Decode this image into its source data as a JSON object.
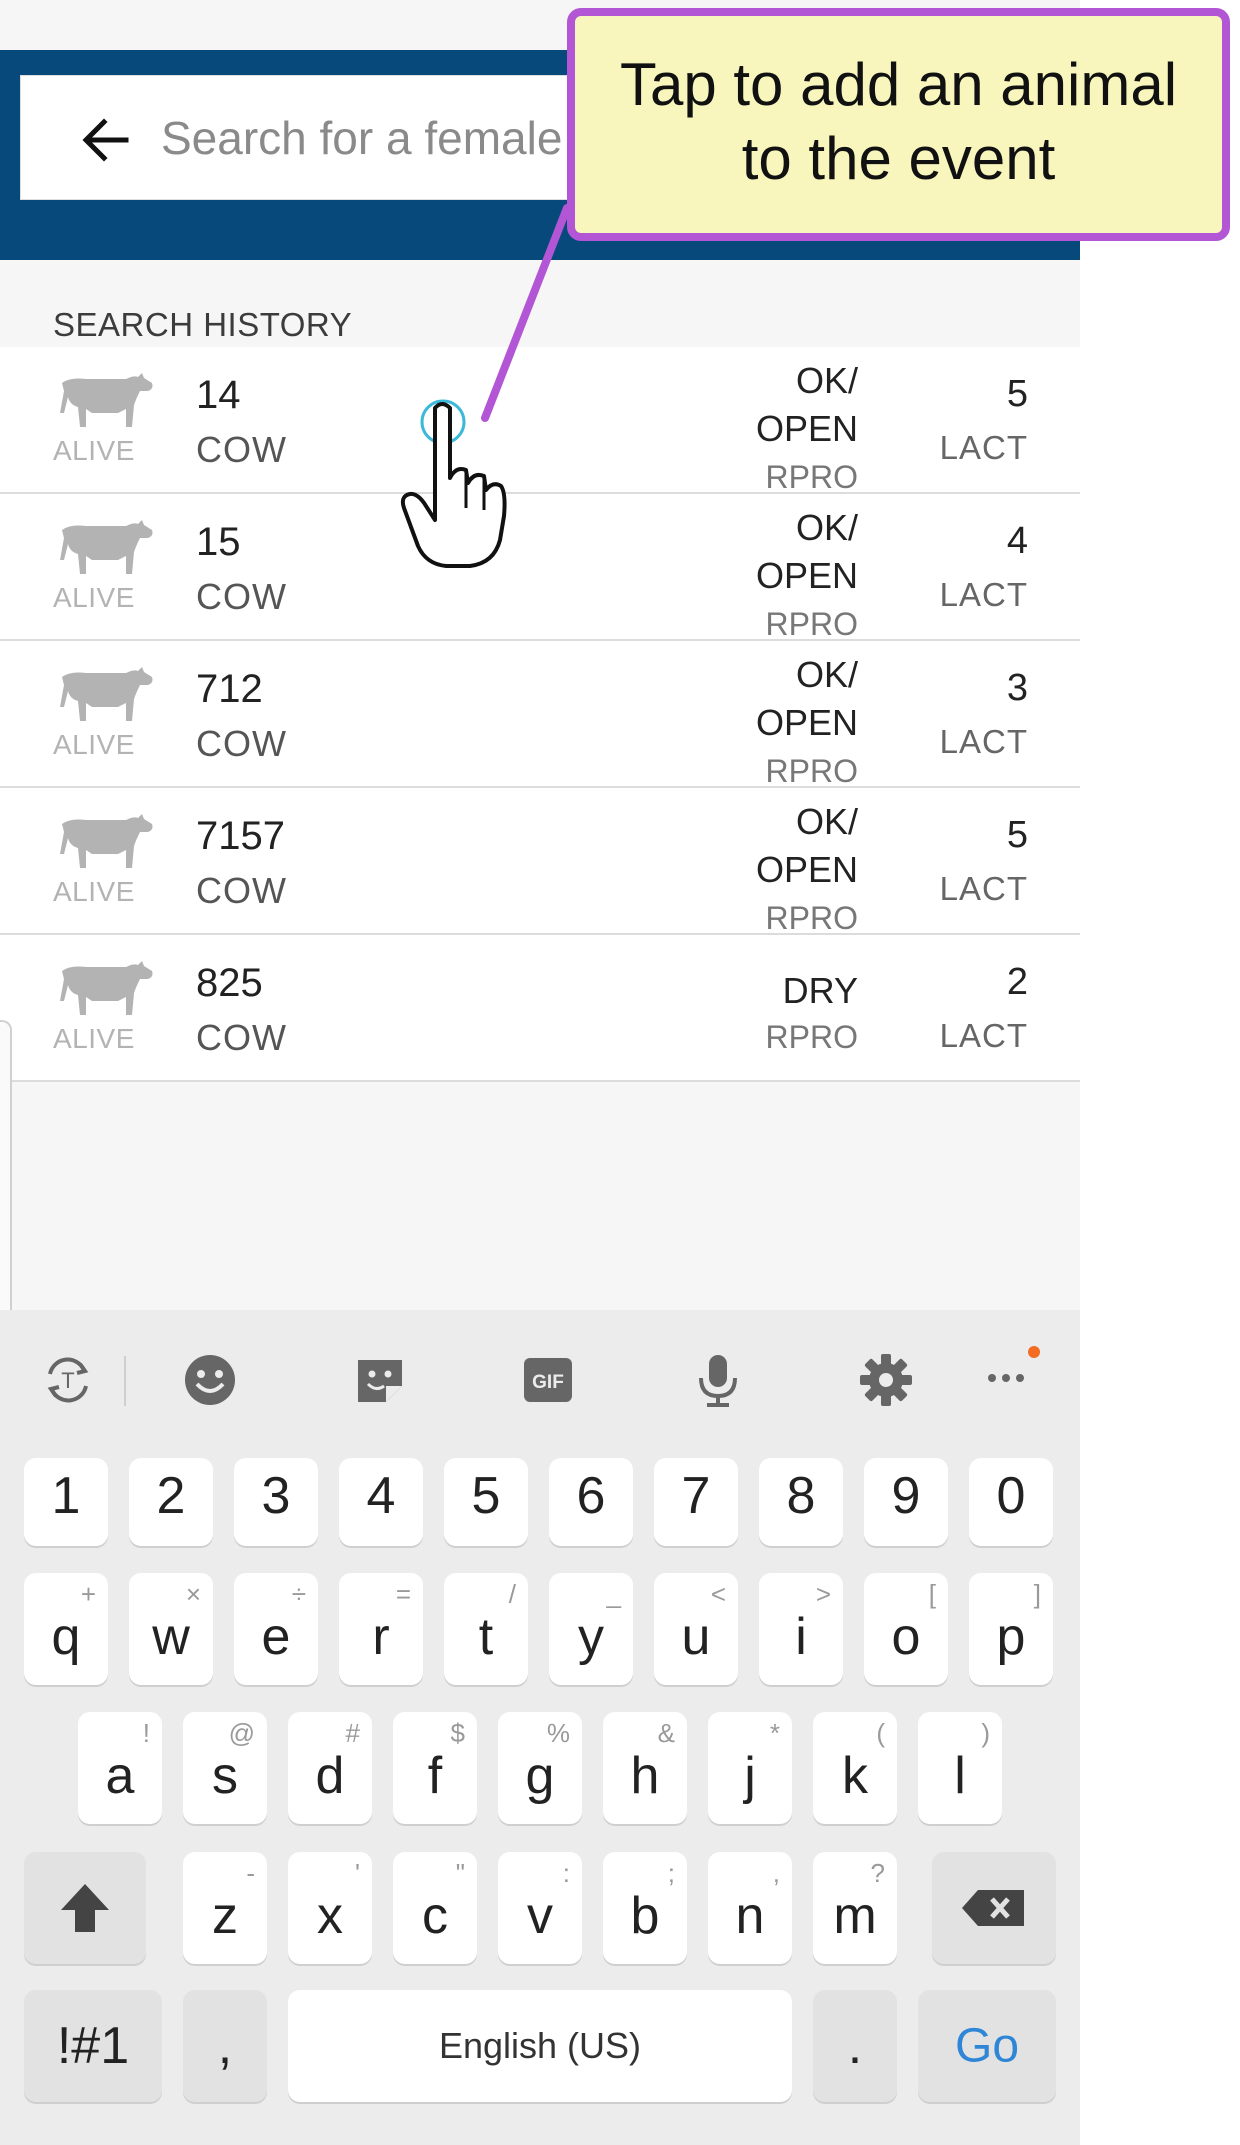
{
  "search": {
    "placeholder": "Search for a female"
  },
  "history": {
    "header": "SEARCH HISTORY",
    "items": [
      {
        "status": "ALIVE",
        "id": "14",
        "type": "COW",
        "repro": "OK/\nOPEN",
        "repro_label": "RPRO",
        "lact": "5",
        "lact_label": "LACT"
      },
      {
        "status": "ALIVE",
        "id": "15",
        "type": "COW",
        "repro": "OK/\nOPEN",
        "repro_label": "RPRO",
        "lact": "4",
        "lact_label": "LACT"
      },
      {
        "status": "ALIVE",
        "id": "712",
        "type": "COW",
        "repro": "OK/\nOPEN",
        "repro_label": "RPRO",
        "lact": "3",
        "lact_label": "LACT"
      },
      {
        "status": "ALIVE",
        "id": "7157",
        "type": "COW",
        "repro": "OK/\nOPEN",
        "repro_label": "RPRO",
        "lact": "5",
        "lact_label": "LACT"
      },
      {
        "status": "ALIVE",
        "id": "825",
        "type": "COW",
        "repro": "DRY",
        "repro_label": "RPRO",
        "lact": "2",
        "lact_label": "LACT"
      }
    ]
  },
  "callout": {
    "line1": "Tap to add an animal",
    "line2": "to the event"
  },
  "keyboard": {
    "numbers": [
      "1",
      "2",
      "3",
      "4",
      "5",
      "6",
      "7",
      "8",
      "9",
      "0"
    ],
    "row1": [
      {
        "k": "q",
        "s": "+"
      },
      {
        "k": "w",
        "s": "×"
      },
      {
        "k": "e",
        "s": "÷"
      },
      {
        "k": "r",
        "s": "="
      },
      {
        "k": "t",
        "s": "/"
      },
      {
        "k": "y",
        "s": "_"
      },
      {
        "k": "u",
        "s": "<"
      },
      {
        "k": "i",
        "s": ">"
      },
      {
        "k": "o",
        "s": "["
      },
      {
        "k": "p",
        "s": "]"
      }
    ],
    "row2": [
      {
        "k": "a",
        "s": "!"
      },
      {
        "k": "s",
        "s": "@"
      },
      {
        "k": "d",
        "s": "#"
      },
      {
        "k": "f",
        "s": "$"
      },
      {
        "k": "g",
        "s": "%"
      },
      {
        "k": "h",
        "s": "&"
      },
      {
        "k": "j",
        "s": "*"
      },
      {
        "k": "k",
        "s": "("
      },
      {
        "k": "l",
        "s": ")"
      }
    ],
    "row3": [
      {
        "k": "z",
        "s": "-"
      },
      {
        "k": "x",
        "s": "'"
      },
      {
        "k": "c",
        "s": "\""
      },
      {
        "k": "v",
        "s": ":"
      },
      {
        "k": "b",
        "s": ";"
      },
      {
        "k": "n",
        "s": ","
      },
      {
        "k": "m",
        "s": "?"
      }
    ],
    "symbols_label": "!#1",
    "comma_label": ",",
    "space_label": "English (US)",
    "period_label": ".",
    "go_label": "Go",
    "gif_label": "GIF",
    "accent_color": "#2f86d6",
    "notification_dot_color": "#f26d21"
  },
  "colors": {
    "header": "#06497a",
    "callout_border": "#b256d6",
    "callout_fill": "#f8f5bd"
  }
}
